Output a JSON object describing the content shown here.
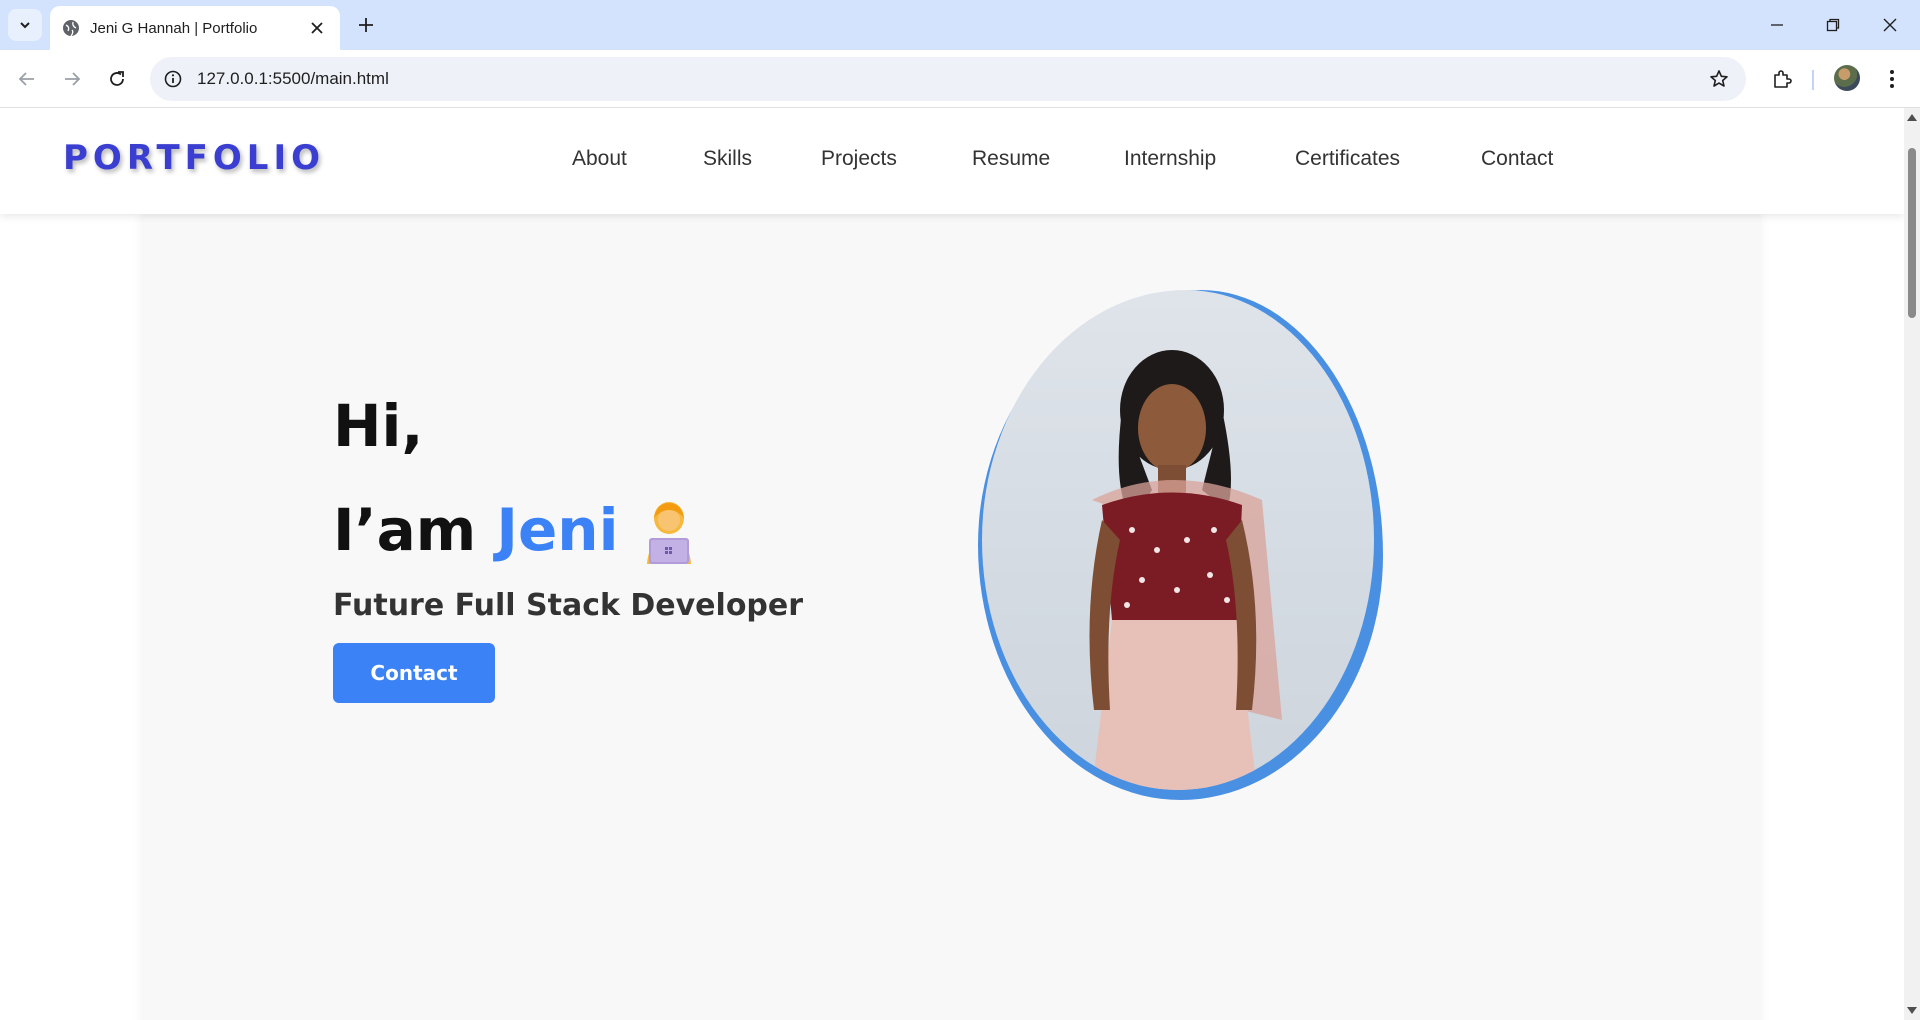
{
  "browser": {
    "tab_title": "Jeni G Hannah | Portfolio",
    "url": "127.0.0.1:5500/main.html"
  },
  "site": {
    "logo": "PORTFOLIO",
    "nav": [
      "About",
      "Skills",
      "Projects",
      "Resume",
      "Internship",
      "Certificates",
      "Contact"
    ]
  },
  "hero": {
    "greeting": "Hi,",
    "iam_prefix": "I’am ",
    "name": "Jeni",
    "role": "Future Full Stack Developer",
    "contact_button": "Contact"
  },
  "colors": {
    "accent": "#3b82f6",
    "logo": "#3b3fd1",
    "tabbar": "#d3e3fd"
  }
}
